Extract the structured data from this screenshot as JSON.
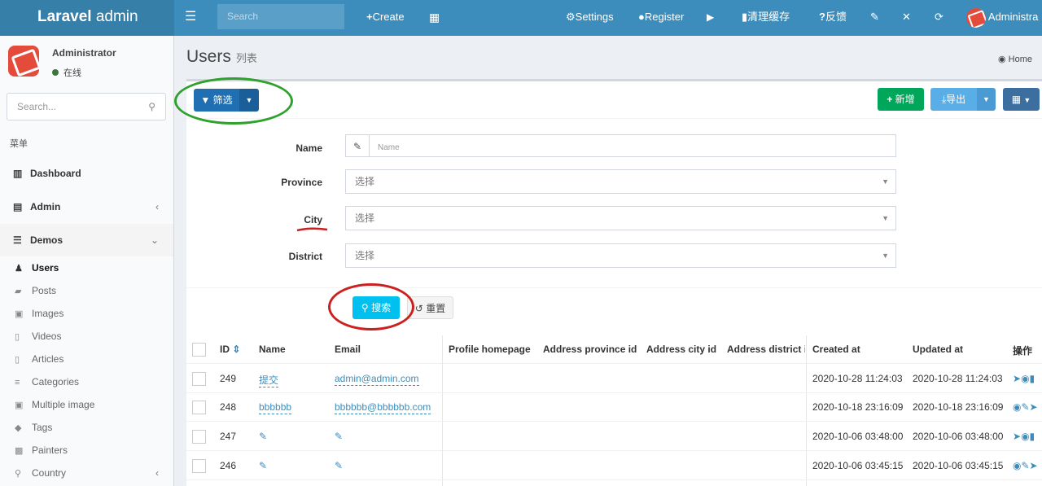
{
  "header": {
    "logo_bold": "Laravel",
    "logo_light": " admin",
    "search_placeholder": "Search",
    "create_label": "Create",
    "settings_label": "Settings",
    "register_label": "Register",
    "clear_cache_label": "清理缓存",
    "feedback_label": "反馈",
    "user_label": "Administra"
  },
  "sidebar": {
    "user_name": "Administrator",
    "user_status": "在线",
    "search_placeholder": "Search...",
    "menu_header": "菜单",
    "items": {
      "dashboard": "Dashboard",
      "admin": "Admin",
      "demos": "Demos",
      "users": "Users",
      "posts": "Posts",
      "images": "Images",
      "videos": "Videos",
      "articles": "Articles",
      "categories": "Categories",
      "multiple_image": "Multiple image",
      "tags": "Tags",
      "painters": "Painters",
      "country": "Country"
    }
  },
  "page": {
    "title": "Users",
    "subtitle": "列表",
    "breadcrumb_home": "Home"
  },
  "toolbar": {
    "filter_label": "筛选",
    "new_label": "新增",
    "export_label": "导出"
  },
  "filter": {
    "name_label": "Name",
    "name_placeholder": "Name",
    "province_label": "Province",
    "city_label": "City",
    "district_label": "District",
    "select_placeholder": "选择",
    "search_label": "搜索",
    "reset_label": "重置"
  },
  "table": {
    "columns": [
      "ID",
      "Name",
      "Email",
      "Profile homepage",
      "Address province id",
      "Address city id",
      "Address district i",
      "Created at",
      "Updated at",
      "操作"
    ],
    "rows": [
      {
        "id": "249",
        "name": "提交",
        "email": "admin@admin.com",
        "created": "2020-10-28 11:24:03",
        "updated": "2020-10-28 11:24:03"
      },
      {
        "id": "248",
        "name": "bbbbbb",
        "email": "bbbbbb@bbbbbb.com",
        "created": "2020-10-18 23:16:09",
        "updated": "2020-10-18 23:16:09"
      },
      {
        "id": "247",
        "name": "",
        "email": "",
        "created": "2020-10-06 03:48:00",
        "updated": "2020-10-06 03:48:00"
      },
      {
        "id": "246",
        "name": "",
        "email": "",
        "created": "2020-10-06 03:45:15",
        "updated": "2020-10-06 03:45:15"
      }
    ]
  },
  "colors": {
    "header": "#3c8dbc",
    "logo_bg": "#367fa9",
    "primary": "#1f6fb2",
    "success": "#00a65a",
    "info": "#00c0ef",
    "export": "#5aaee8",
    "annotation_green": "#2ea12e",
    "annotation_red": "#cc1f1f"
  }
}
